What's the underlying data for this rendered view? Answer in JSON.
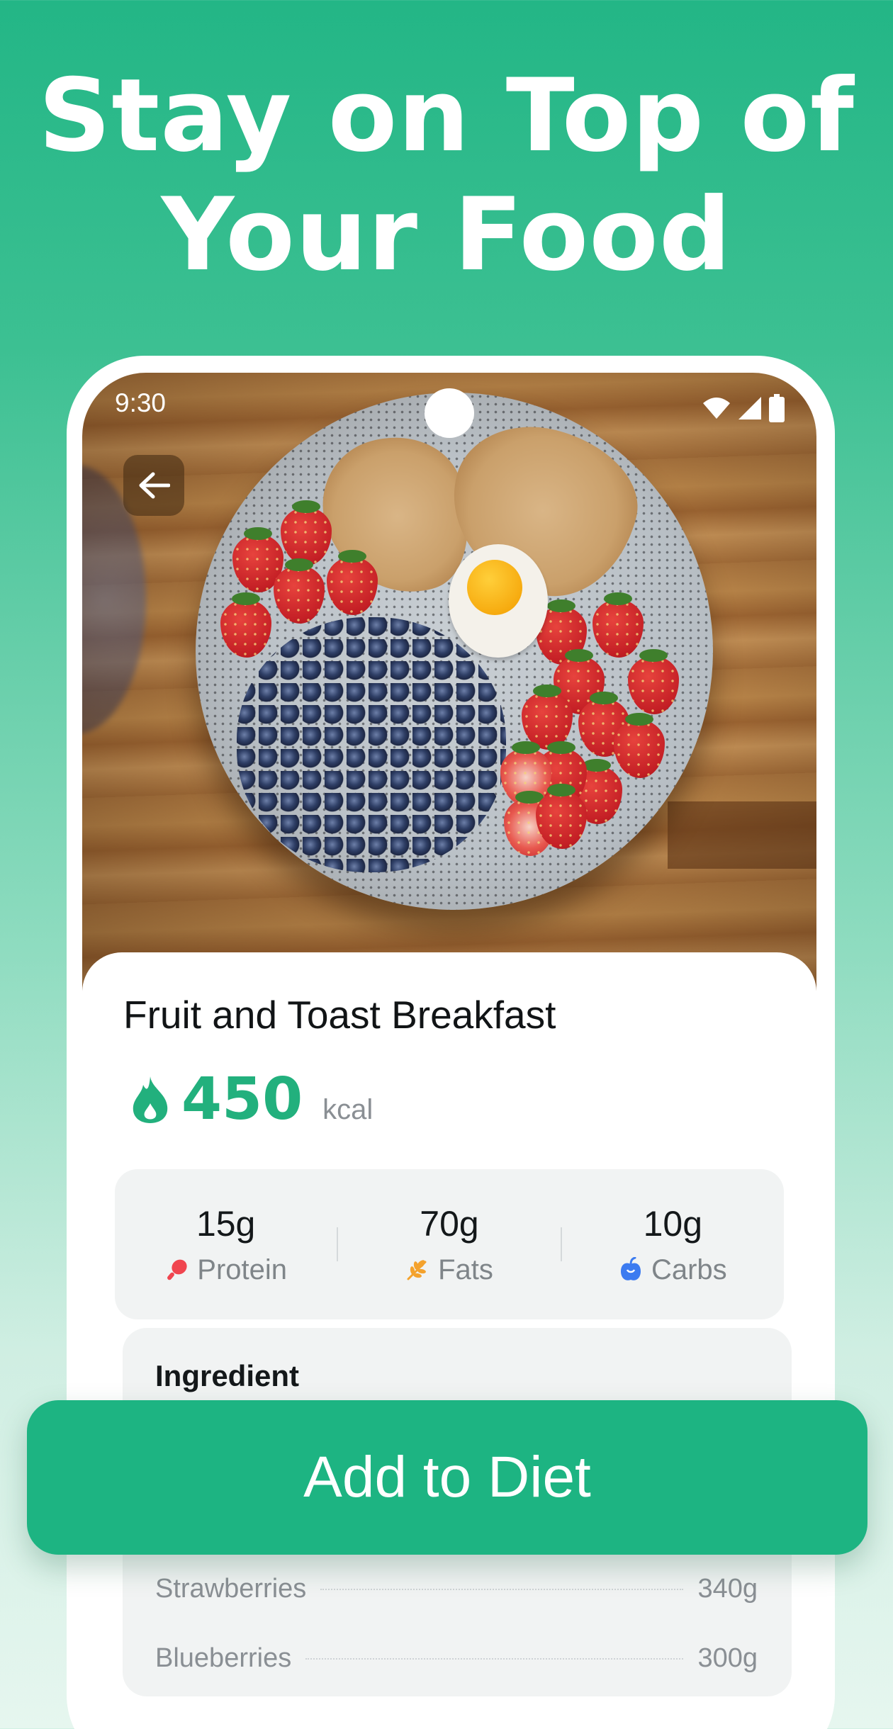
{
  "headline": {
    "line1": "Stay on Top of",
    "line2": "Your Food"
  },
  "status_bar": {
    "time": "9:30",
    "icons": [
      "wifi-icon",
      "signal-icon",
      "battery-icon"
    ]
  },
  "navigation": {
    "back_icon": "arrow-left-icon"
  },
  "meal": {
    "title": "Fruit and Toast Breakfast",
    "calories": "450",
    "calorie_unit": "kcal",
    "accent_color": "#22b07d"
  },
  "macros": [
    {
      "value": "15g",
      "label": "Protein",
      "icon": "drumstick-icon",
      "color": "#f0454f"
    },
    {
      "value": "70g",
      "label": "Fats",
      "icon": "wheat-icon",
      "color": "#f4a22d"
    },
    {
      "value": "10g",
      "label": "Carbs",
      "icon": "apple-icon",
      "color": "#3c7bf0"
    }
  ],
  "ingredients": {
    "title": "Ingredient",
    "items": [
      {
        "name": "Strawberries",
        "amount": "340g"
      },
      {
        "name": "Blueberries",
        "amount": "300g"
      }
    ]
  },
  "cta": {
    "label": "Add to Diet",
    "color": "#1db482"
  }
}
